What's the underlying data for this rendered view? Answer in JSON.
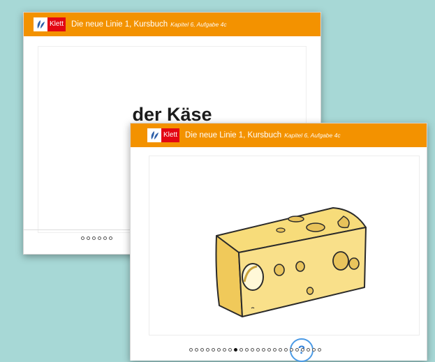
{
  "header": {
    "logo_text": "Klett",
    "title": "Die neue Linie 1, Kursbuch",
    "subtitle": "Kapitel 6, Aufgabe 4c"
  },
  "back_card": {
    "word": "der Käse",
    "audio_icon": "speaker-icon",
    "pagination": {
      "visible_dots": 6
    }
  },
  "front_card": {
    "image": "cheese-wedge",
    "help_label": "?",
    "pagination": {
      "total": 24,
      "active_index": 8
    }
  },
  "colors": {
    "background": "#a7d8d6",
    "header_orange": "#f39200",
    "logo_red": "#e30613",
    "help_blue": "#4a9ae6"
  }
}
